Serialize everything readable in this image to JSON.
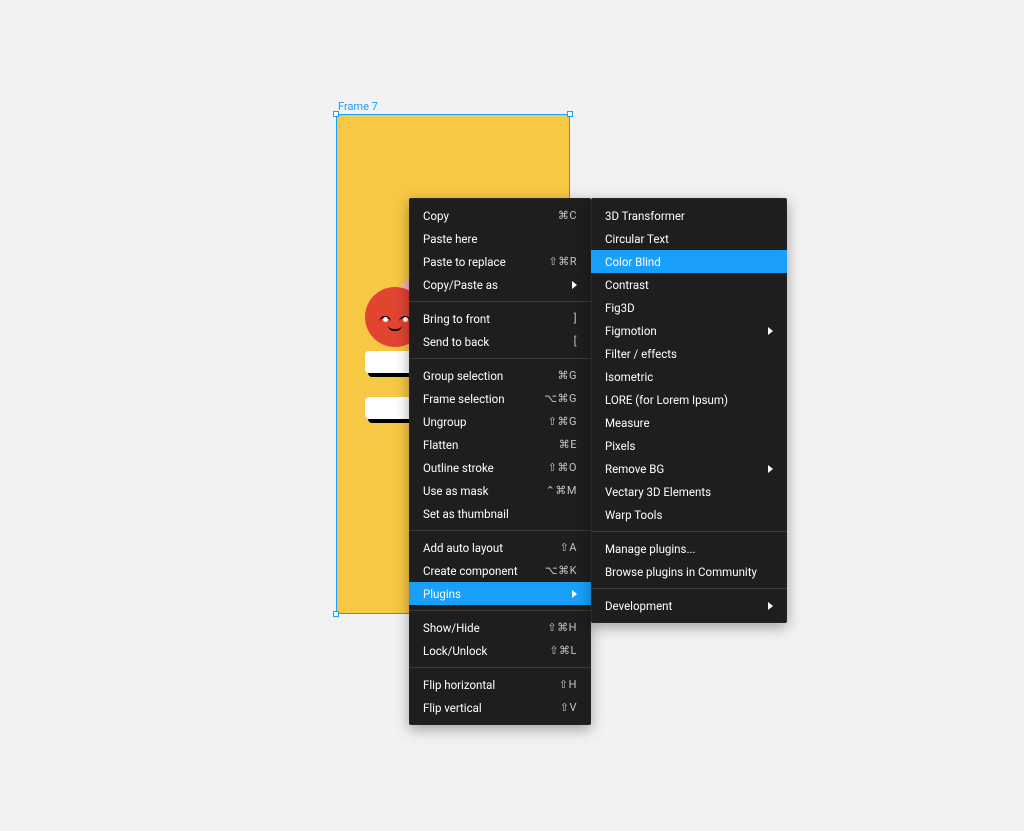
{
  "frame_label": "Frame 7",
  "menu_main": [
    [
      {
        "label": "Copy",
        "shortcut": "⌘C"
      },
      {
        "label": "Paste here"
      },
      {
        "label": "Paste to replace",
        "shortcut": "⇧⌘R"
      },
      {
        "label": "Copy/Paste as",
        "submenu": true
      }
    ],
    [
      {
        "label": "Bring to front",
        "shortcut": "]"
      },
      {
        "label": "Send to back",
        "shortcut": "["
      }
    ],
    [
      {
        "label": "Group selection",
        "shortcut": "⌘G"
      },
      {
        "label": "Frame selection",
        "shortcut": "⌥⌘G"
      },
      {
        "label": "Ungroup",
        "shortcut": "⇧⌘G"
      },
      {
        "label": "Flatten",
        "shortcut": "⌘E"
      },
      {
        "label": "Outline stroke",
        "shortcut": "⇧⌘O"
      },
      {
        "label": "Use as mask",
        "shortcut": "⌃⌘M"
      },
      {
        "label": "Set as thumbnail"
      }
    ],
    [
      {
        "label": "Add auto layout",
        "shortcut": "⇧A"
      },
      {
        "label": "Create component",
        "shortcut": "⌥⌘K"
      },
      {
        "label": "Plugins",
        "submenu": true,
        "highlight": true
      }
    ],
    [
      {
        "label": "Show/Hide",
        "shortcut": "⇧⌘H"
      },
      {
        "label": "Lock/Unlock",
        "shortcut": "⇧⌘L"
      }
    ],
    [
      {
        "label": "Flip horizontal",
        "shortcut": "⇧H"
      },
      {
        "label": "Flip vertical",
        "shortcut": "⇧V"
      }
    ]
  ],
  "menu_sub": [
    [
      {
        "label": "3D Transformer"
      },
      {
        "label": "Circular Text"
      },
      {
        "label": "Color Blind",
        "highlight": true
      },
      {
        "label": "Contrast"
      },
      {
        "label": "Fig3D"
      },
      {
        "label": "Figmotion",
        "submenu": true
      },
      {
        "label": "Filter / effects"
      },
      {
        "label": "Isometric"
      },
      {
        "label": "LORE (for Lorem Ipsum)"
      },
      {
        "label": "Measure"
      },
      {
        "label": "Pixels"
      },
      {
        "label": "Remove BG",
        "submenu": true
      },
      {
        "label": "Vectary 3D Elements"
      },
      {
        "label": "Warp Tools"
      }
    ],
    [
      {
        "label": "Manage plugins..."
      },
      {
        "label": "Browse plugins in Community"
      }
    ],
    [
      {
        "label": "Development",
        "submenu": true
      }
    ]
  ]
}
